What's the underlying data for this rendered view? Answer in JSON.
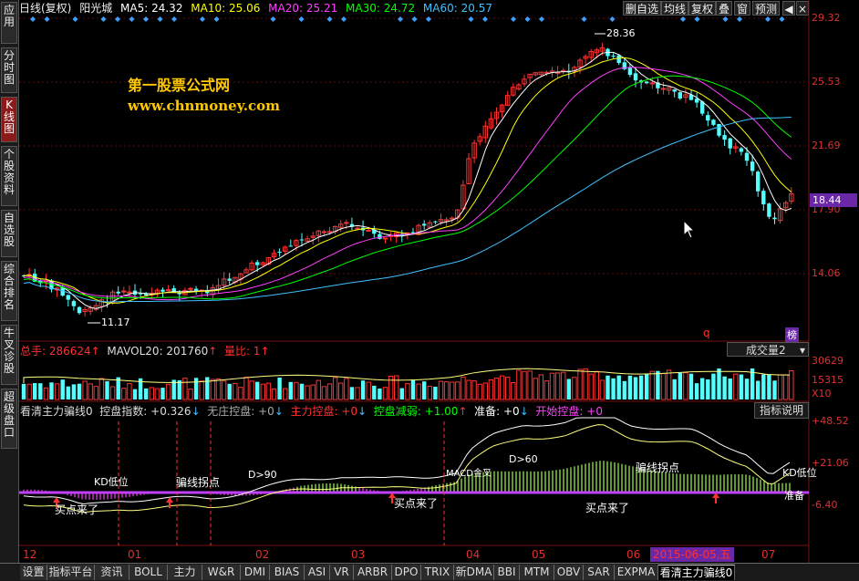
{
  "sidebar": {
    "items": [
      {
        "label": "应用",
        "active": false
      },
      {
        "label": "分时图",
        "active": false
      },
      {
        "label": "K线图",
        "active": true
      },
      {
        "label": "个股资料",
        "active": false
      },
      {
        "label": "自选股",
        "active": false
      },
      {
        "label": "综合排名",
        "active": false
      },
      {
        "label": "牛叉诊股",
        "active": false
      },
      {
        "label": "超级盘口",
        "active": false
      }
    ]
  },
  "header": {
    "chart_kind": "日线(复权)",
    "stock_name": "阳光城",
    "ma5": "MA5: 24.32",
    "ma10": "MA10: 25.06",
    "ma20": "MA20: 25.21",
    "ma30": "MA30: 24.72",
    "ma60": "MA60: 20.57",
    "toolbar": [
      "删自选",
      "均线",
      "复权",
      "叠",
      "窗",
      "预测"
    ]
  },
  "price_axis": {
    "labels": [
      "29.32",
      "25.53",
      "21.69",
      "17.90",
      "14.06"
    ],
    "current_price": "18.44",
    "side_mark": "榜",
    "q_mark": "q"
  },
  "annotations": {
    "high": "28.36",
    "low": "11.17",
    "watermark_cn": "第一股票公式网",
    "watermark_url": "www.chnmoney.com"
  },
  "volume": {
    "total": "总手: 286624",
    "mavol": "MAVOL20: 201760",
    "ratio": "量比: 1",
    "selector": "成交量2",
    "labels": [
      "30629",
      "15315",
      "X10"
    ]
  },
  "indicator": {
    "name": "看清主力骗线0",
    "kongpan": "控盘指数: +0.326",
    "wuzhuang": "无庄控盘: +0",
    "zhuli": "主力控盘: +0",
    "jianruo": "控盘减弱: +1.00",
    "zhunbei": "准备: +0",
    "kaishi": "开始控盘: +0",
    "help": "指标说明",
    "labels": [
      "+48.52",
      "+21.06",
      "-6.40"
    ],
    "signals": [
      "买点来了",
      "买点来了",
      "买点来了",
      "骗线拐点",
      "骗线拐点",
      "KD低位",
      "KD低位",
      "准备",
      "D>90",
      "D>60",
      "MACD金叉"
    ]
  },
  "time_axis": {
    "months": [
      "12",
      "01",
      "02",
      "03",
      "04",
      "05",
      "06",
      "07"
    ],
    "cursor_date": "2015-06-05,五"
  },
  "tabs": [
    "设置",
    "指标平台",
    "资讯",
    "BOLL",
    "主力",
    "W&R",
    "DMI",
    "BIAS",
    "ASI",
    "VR",
    "ARBR",
    "DPO",
    "TRIX",
    "新DMA",
    "BBI",
    "MTM",
    "OBV",
    "SAR",
    "EXPMA",
    "看清主力骗线0"
  ],
  "colors": {
    "up": "#ff3232",
    "down": "#54ffff",
    "ma5": "#ffffff",
    "ma10": "#ffff00",
    "ma20": "#ff40ff",
    "ma30": "#00ff00",
    "ma60": "#40c0ff"
  }
}
